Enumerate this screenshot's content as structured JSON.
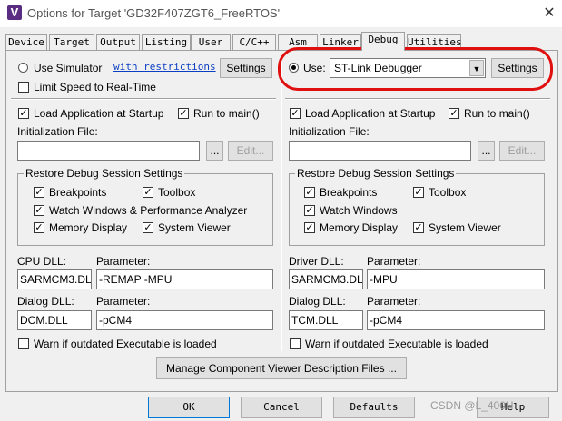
{
  "window": {
    "title": "Options for Target 'GD32F407ZGT6_FreeRTOS'",
    "icon": "V",
    "close": "✕"
  },
  "tabs": [
    {
      "label": "Device"
    },
    {
      "label": "Target"
    },
    {
      "label": "Output"
    },
    {
      "label": "Listing"
    },
    {
      "label": "User"
    },
    {
      "label": "C/C++"
    },
    {
      "label": "Asm"
    },
    {
      "label": "Linker"
    },
    {
      "label": "Debug"
    },
    {
      "label": "Utilities"
    }
  ],
  "active_tab": "Debug",
  "left": {
    "use_simulator": "Use Simulator",
    "restrictions_link": "with restrictions",
    "settings": "Settings",
    "limit_speed": "Limit Speed to Real-Time",
    "load_app": "Load Application at Startup",
    "run_main": "Run to main()",
    "init_file_label": "Initialization File:",
    "browse": "...",
    "edit": "Edit...",
    "restore_group": "Restore Debug Session Settings",
    "breakpoints": "Breakpoints",
    "toolbox": "Toolbox",
    "watch": "Watch Windows & Performance Analyzer",
    "memory": "Memory Display",
    "sysviewer": "System Viewer",
    "cpu_dll_label": "CPU DLL:",
    "param_label": "Parameter:",
    "cpu_dll": "SARMCM3.DLL",
    "cpu_param": "-REMAP -MPU",
    "dialog_dll_label": "Dialog DLL:",
    "dialog_dll": "DCM.DLL",
    "dialog_param": "-pCM4",
    "warn": "Warn if outdated Executable is loaded"
  },
  "right": {
    "use_label": "Use:",
    "debugger": "ST-Link Debugger",
    "settings": "Settings",
    "load_app": "Load Application at Startup",
    "run_main": "Run to main()",
    "init_file_label": "Initialization File:",
    "browse": "...",
    "edit": "Edit...",
    "restore_group": "Restore Debug Session Settings",
    "breakpoints": "Breakpoints",
    "toolbox": "Toolbox",
    "watch": "Watch Windows",
    "memory": "Memory Display",
    "sysviewer": "System Viewer",
    "driver_dll_label": "Driver DLL:",
    "param_label": "Parameter:",
    "driver_dll": "SARMCM3.DLL",
    "driver_param": "-MPU",
    "dialog_dll_label": "Dialog DLL:",
    "dialog_dll": "TCM.DLL",
    "dialog_param": "-pCM4",
    "warn": "Warn if outdated Executable is loaded"
  },
  "manage_button": "Manage Component Viewer Description Files ...",
  "footer": {
    "ok": "OK",
    "cancel": "Cancel",
    "defaults": "Defaults",
    "help": "Help"
  },
  "check_mark": "✓",
  "combo_arrow": "▼",
  "watermark": "CSDN @L_400H",
  "colors": {
    "highlight": "#e01010",
    "link": "#0a3ec2",
    "app_icon": "#5a2d82"
  }
}
